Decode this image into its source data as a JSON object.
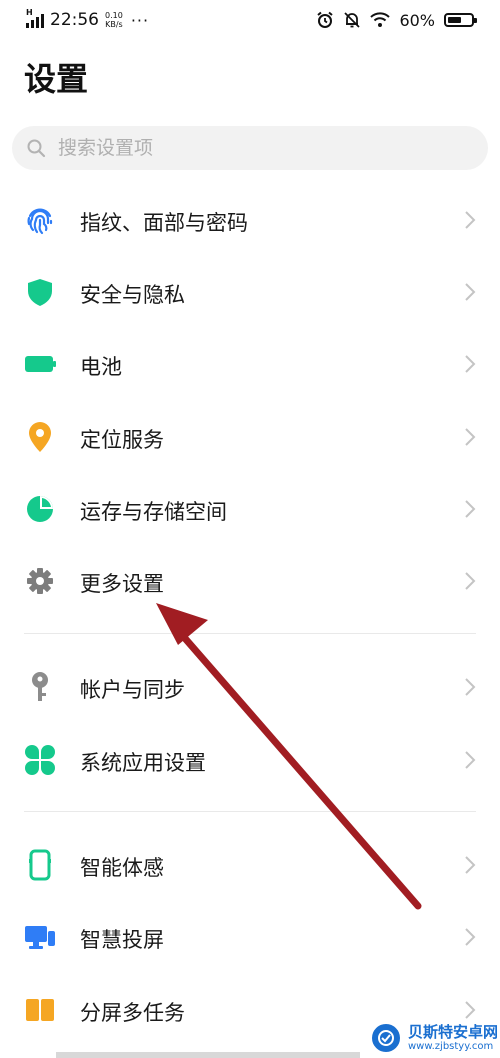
{
  "status_bar": {
    "network": "H",
    "time": "22:56",
    "speed_value": "0.10",
    "speed_unit": "KB/s",
    "more": "···",
    "battery_text": "60%",
    "battery_level": 0.6
  },
  "page_title": "设置",
  "search": {
    "placeholder": "搜索设置项"
  },
  "items": [
    {
      "label": "指纹、面部与密码",
      "icon": "fingerprint-icon",
      "color": "#2f7df6"
    },
    {
      "label": "安全与隐私",
      "icon": "shield-icon",
      "color": "#15c98c"
    },
    {
      "label": "电池",
      "icon": "battery-icon",
      "color": "#15c98c"
    },
    {
      "label": "定位服务",
      "icon": "location-pin-icon",
      "color": "#f5a623"
    },
    {
      "label": "运存与存储空间",
      "icon": "pie-chart-icon",
      "color": "#15c98c"
    },
    {
      "label": "更多设置",
      "icon": "gear-icon",
      "color": "#7d7d7d"
    },
    {
      "label": "帐户与同步",
      "icon": "key-icon",
      "color": "#8c8c8c"
    },
    {
      "label": "系统应用设置",
      "icon": "four-leaf-icon",
      "color": "#15c98c"
    },
    {
      "label": "智能体感",
      "icon": "phone-outline-icon",
      "color": "#15c98c"
    },
    {
      "label": "智慧投屏",
      "icon": "screen-cast-icon",
      "color": "#2f7df6"
    },
    {
      "label": "分屏多任务",
      "icon": "split-screen-icon",
      "color": "#f5a623"
    }
  ],
  "annotation": {
    "arrow_color": "#a11d22"
  },
  "watermark": {
    "title": "贝斯特安卓网",
    "url": "www.zjbstyy.com"
  }
}
